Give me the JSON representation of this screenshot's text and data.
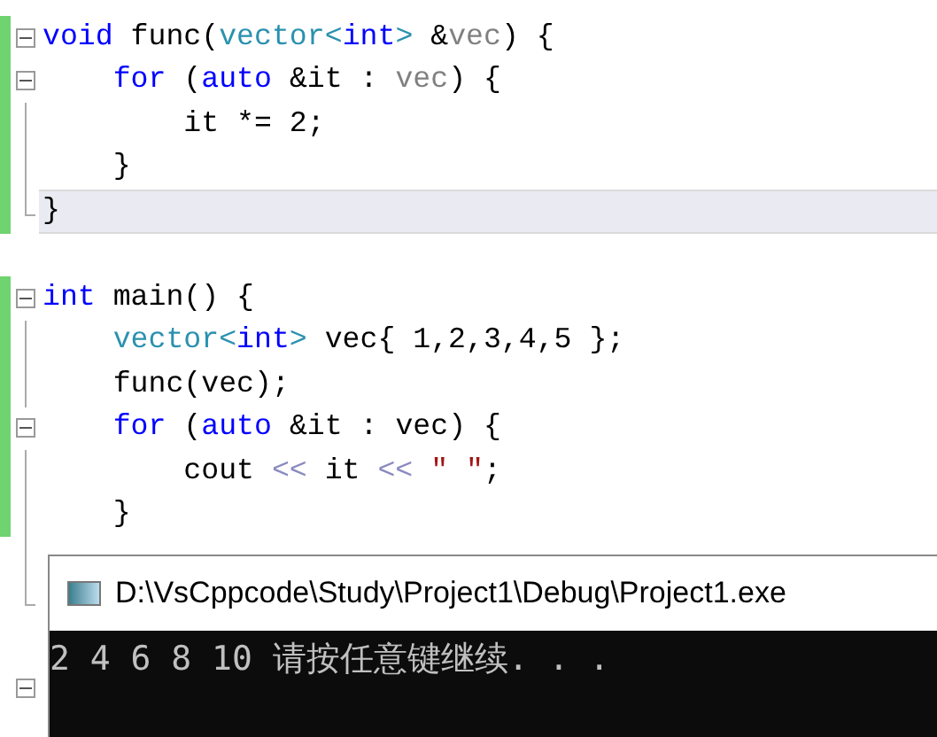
{
  "editor": {
    "lines": [
      {
        "kind": "start",
        "changed": true,
        "current": false,
        "tokens": [
          {
            "kind": "keyword",
            "text": "void"
          },
          {
            "kind": "plain",
            "text": " func("
          },
          {
            "kind": "type",
            "text": "vector<"
          },
          {
            "kind": "keyword",
            "text": "int"
          },
          {
            "kind": "type",
            "text": ">"
          },
          {
            "kind": "plain",
            "text": " &"
          },
          {
            "kind": "param",
            "text": "vec"
          },
          {
            "kind": "plain",
            "text": ") {"
          }
        ]
      },
      {
        "kind": "start",
        "changed": true,
        "current": false,
        "tokens": [
          {
            "kind": "keyword",
            "text": "    for"
          },
          {
            "kind": "plain",
            "text": " ("
          },
          {
            "kind": "keyword",
            "text": "auto"
          },
          {
            "kind": "plain",
            "text": " &it : "
          },
          {
            "kind": "param",
            "text": "vec"
          },
          {
            "kind": "plain",
            "text": ") {"
          }
        ]
      },
      {
        "kind": "inside",
        "changed": true,
        "current": false,
        "tokens": [
          {
            "kind": "plain",
            "text": "        it *= 2;"
          }
        ]
      },
      {
        "kind": "inside",
        "changed": true,
        "current": false,
        "tokens": [
          {
            "kind": "plain",
            "text": "    }"
          }
        ]
      },
      {
        "kind": "end",
        "changed": true,
        "current": true,
        "tokens": [
          {
            "kind": "plain",
            "text": "}"
          }
        ]
      },
      {
        "kind": "plain",
        "changed": false,
        "current": false
      },
      {
        "kind": "start",
        "changed": true,
        "current": false,
        "tokens": [
          {
            "kind": "keyword",
            "text": "int"
          },
          {
            "kind": "plain",
            "text": " main() {"
          }
        ]
      },
      {
        "kind": "inside",
        "changed": true,
        "current": false,
        "tokens": [
          {
            "kind": "type",
            "text": "    vector<"
          },
          {
            "kind": "keyword",
            "text": "int"
          },
          {
            "kind": "type",
            "text": ">"
          },
          {
            "kind": "plain",
            "text": " vec{ 1,2,3,4,5 };"
          }
        ]
      },
      {
        "kind": "inside",
        "changed": true,
        "current": false,
        "tokens": [
          {
            "kind": "plain",
            "text": "    func(vec);"
          }
        ]
      },
      {
        "kind": "start",
        "changed": true,
        "current": false,
        "tokens": [
          {
            "kind": "keyword",
            "text": "    for"
          },
          {
            "kind": "plain",
            "text": " ("
          },
          {
            "kind": "keyword",
            "text": "auto"
          },
          {
            "kind": "plain",
            "text": " &it : vec) {"
          }
        ]
      },
      {
        "kind": "inside",
        "changed": true,
        "current": false,
        "tokens": [
          {
            "kind": "plain",
            "text": "        cout "
          },
          {
            "kind": "operator",
            "text": "<<"
          },
          {
            "kind": "plain",
            "text": " it "
          },
          {
            "kind": "operator",
            "text": "<<"
          },
          {
            "kind": "string",
            "text": " \" \""
          },
          {
            "kind": "plain",
            "text": ";"
          }
        ]
      },
      {
        "kind": "inside",
        "changed": true,
        "current": false,
        "tokens": [
          {
            "kind": "plain",
            "text": "    }"
          }
        ]
      },
      {
        "kind": "inside",
        "changed": false,
        "current": false
      },
      {
        "kind": "end",
        "changed": false,
        "current": false
      },
      {
        "kind": "plain",
        "changed": false,
        "current": false
      },
      {
        "kind": "start",
        "changed": false,
        "current": false
      }
    ]
  },
  "console": {
    "title": "D:\\VsCppcode\\Study\\Project1\\Debug\\Project1.exe",
    "output": "2 4 6 8 10 请按任意键继续. . ."
  }
}
